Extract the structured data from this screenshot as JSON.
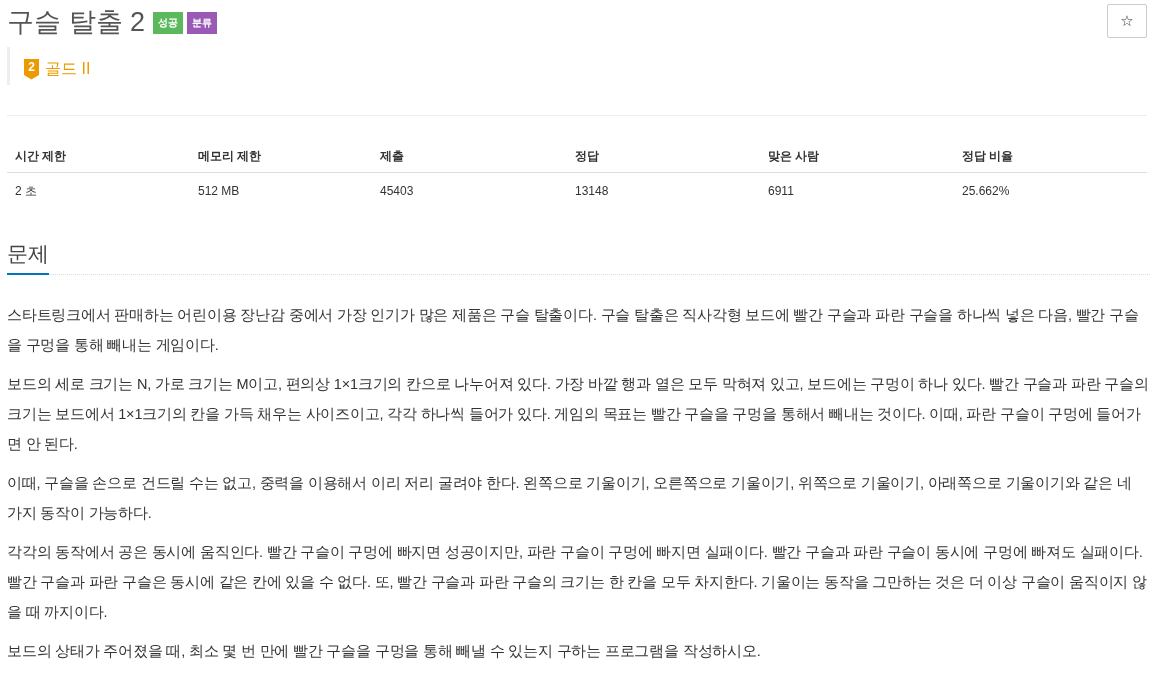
{
  "title": "구슬 탈출 2",
  "badges": [
    {
      "label": "성공",
      "color": "#5cb85c"
    },
    {
      "label": "분류",
      "color": "#9b59b6"
    }
  ],
  "star_button": {
    "label": "☆"
  },
  "tier": {
    "number": "2",
    "label": "골드 II"
  },
  "stats": {
    "columns": [
      "시간 제한",
      "메모리 제한",
      "제출",
      "정답",
      "맞은 사람",
      "정답 비율"
    ],
    "rows": [
      [
        "2 초",
        "512 MB",
        "45403",
        "13148",
        "6911",
        "25.662%"
      ]
    ]
  },
  "section": {
    "heading": "문제",
    "paragraphs": [
      "스타트링크에서 판매하는 어린이용 장난감 중에서 가장 인기가 많은 제품은 구슬 탈출이다. 구슬 탈출은 직사각형 보드에 빨간 구슬과 파란 구슬을 하나씩 넣은 다음, 빨간 구슬을 구멍을 통해 빼내는 게임이다.",
      "보드의 세로 크기는 N, 가로 크기는 M이고, 편의상 1×1크기의 칸으로 나누어져 있다. 가장 바깥 행과 열은 모두 막혀져 있고, 보드에는 구멍이 하나 있다. 빨간 구슬과 파란 구슬의 크기는 보드에서 1×1크기의 칸을 가득 채우는 사이즈이고, 각각 하나씩 들어가 있다. 게임의 목표는 빨간 구슬을 구멍을 통해서 빼내는 것이다. 이때, 파란 구슬이 구멍에 들어가면 안 된다.",
      "이때, 구슬을 손으로 건드릴 수는 없고, 중력을 이용해서 이리 저리 굴려야 한다. 왼쪽으로 기울이기, 오른쪽으로 기울이기, 위쪽으로 기울이기, 아래쪽으로 기울이기와 같은 네 가지 동작이 가능하다.",
      "각각의 동작에서 공은 동시에 움직인다. 빨간 구슬이 구멍에 빠지면 성공이지만, 파란 구슬이 구멍에 빠지면 실패이다. 빨간 구슬과 파란 구슬이 동시에 구멍에 빠져도 실패이다. 빨간 구슬과 파란 구슬은 동시에 같은 칸에 있을 수 없다. 또, 빨간 구슬과 파란 구슬의 크기는 한 칸을 모두 차지한다. 기울이는 동작을 그만하는 것은 더 이상 구슬이 움직이지 않을 때 까지이다.",
      "보드의 상태가 주어졌을 때, 최소 몇 번 만에 빨간 구슬을 구멍을 통해 빼낼 수 있는지 구하는 프로그램을 작성하시오."
    ]
  }
}
